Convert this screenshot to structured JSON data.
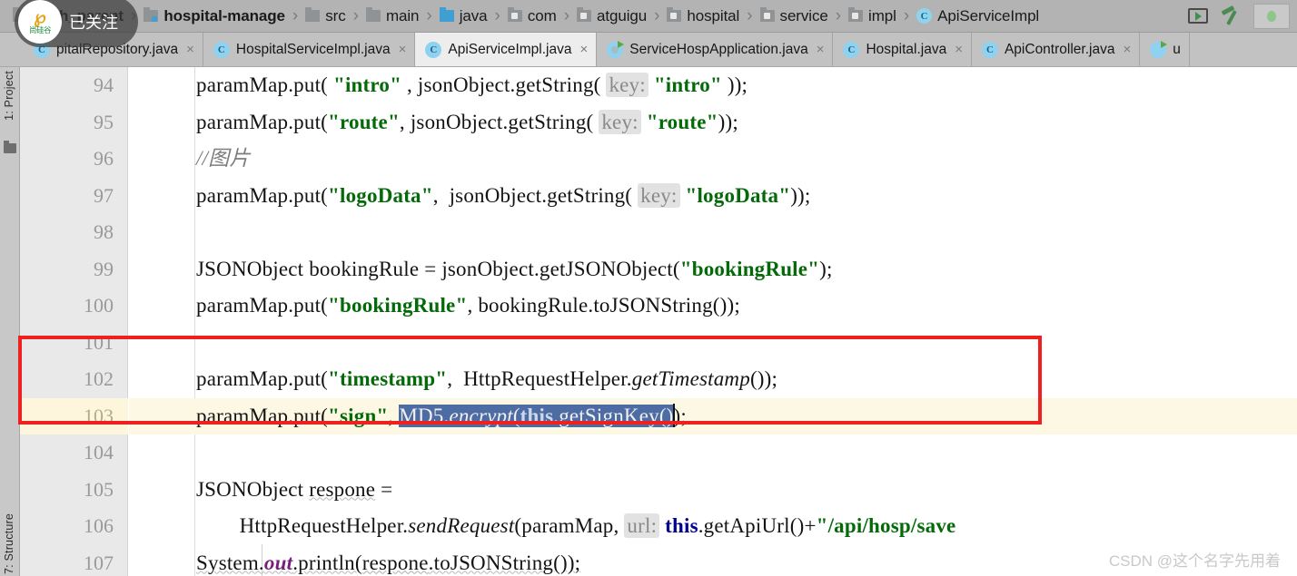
{
  "breadcrumb": {
    "items": [
      {
        "label": "yygh_parent",
        "icon": "module-folder-icon",
        "bold": true
      },
      {
        "label": "hospital-manage",
        "icon": "module-folder-icon",
        "bold": true
      },
      {
        "label": "src",
        "icon": "source-folder-icon",
        "bold": false
      },
      {
        "label": "main",
        "icon": "source-folder-icon",
        "bold": false
      },
      {
        "label": "java",
        "icon": "source-root-folder-icon",
        "bold": false
      },
      {
        "label": "com",
        "icon": "package-folder-icon",
        "bold": false
      },
      {
        "label": "atguigu",
        "icon": "package-folder-icon",
        "bold": false
      },
      {
        "label": "hospital",
        "icon": "package-folder-icon",
        "bold": false
      },
      {
        "label": "service",
        "icon": "package-folder-icon",
        "bold": false
      },
      {
        "label": "impl",
        "icon": "package-folder-icon",
        "bold": false
      },
      {
        "label": "ApiServiceImpl",
        "icon": "java-class-icon",
        "bold": false
      }
    ],
    "separator": "›",
    "actions": [
      {
        "name": "run-icon",
        "label": "Run"
      },
      {
        "name": "build-hammer-icon",
        "label": "Build Project"
      }
    ]
  },
  "tabs": [
    {
      "label": "pitalRepository.java",
      "icon": "java-class-icon",
      "active": false,
      "close": "×",
      "truncated": true
    },
    {
      "label": "HospitalServiceImpl.java",
      "icon": "java-class-icon",
      "active": false,
      "close": "×"
    },
    {
      "label": "ApiServiceImpl.java",
      "icon": "java-class-icon",
      "active": true,
      "close": "×"
    },
    {
      "label": "ServiceHospApplication.java",
      "icon": "spring-boot-class-icon",
      "active": false,
      "close": "×"
    },
    {
      "label": "Hospital.java",
      "icon": "java-class-icon",
      "active": false,
      "close": "×"
    },
    {
      "label": "ApiController.java",
      "icon": "java-class-icon",
      "active": false,
      "close": "×"
    },
    {
      "label": "u",
      "icon": "spring-boot-class-icon",
      "active": false,
      "close": "",
      "truncated": true
    }
  ],
  "tool_windows": {
    "project": "1: Project",
    "structure": "7: Structure"
  },
  "editor": {
    "current_line": 103,
    "selection_text": "MD5.encrypt(this.getSignKey()",
    "lines": [
      {
        "no": "94",
        "text": "paramMap.put( \"intro\" , jsonObject.getString( key: \"intro\" ));"
      },
      {
        "no": "95",
        "text": "paramMap.put(\"route\", jsonObject.getString( key: \"route\"));"
      },
      {
        "no": "96",
        "text": "//图片"
      },
      {
        "no": "97",
        "text": "paramMap.put(\"logoData\",  jsonObject.getString( key: \"logoData\"));"
      },
      {
        "no": "98",
        "text": ""
      },
      {
        "no": "99",
        "text": "JSONObject bookingRule = jsonObject.getJSONObject(\"bookingRule\");"
      },
      {
        "no": "100",
        "text": "paramMap.put(\"bookingRule\", bookingRule.toJSONString());"
      },
      {
        "no": "101",
        "text": ""
      },
      {
        "no": "102",
        "text": "paramMap.put(\"timestamp\",  HttpRequestHelper.getTimestamp());"
      },
      {
        "no": "103",
        "text": "paramMap.put(\"sign\", MD5.encrypt(this.getSignKey()));"
      },
      {
        "no": "104",
        "text": ""
      },
      {
        "no": "105",
        "text": "JSONObject respone ="
      },
      {
        "no": "106",
        "text": "        HttpRequestHelper.sendRequest(paramMap,  url: this.getApiUrl()+\"/api/hosp/save"
      },
      {
        "no": "107",
        "text": "System.out.println(respone.toJSONString());"
      }
    ]
  },
  "annotation": {
    "box_color": "#ef2020",
    "name": "red-highlight-box"
  },
  "overlay": {
    "logo_mark": "℘",
    "logo_text": "尚硅谷",
    "follow_label": "已关注"
  },
  "watermark": {
    "text": "CSDN @这个名字先用着"
  },
  "colors": {
    "string_green": "#046a09",
    "keyword_blue": "#00008c",
    "selection_blue": "#4e6ca4",
    "current_line_yellow": "#fdf8e3",
    "annotation_red": "#ef2020"
  }
}
